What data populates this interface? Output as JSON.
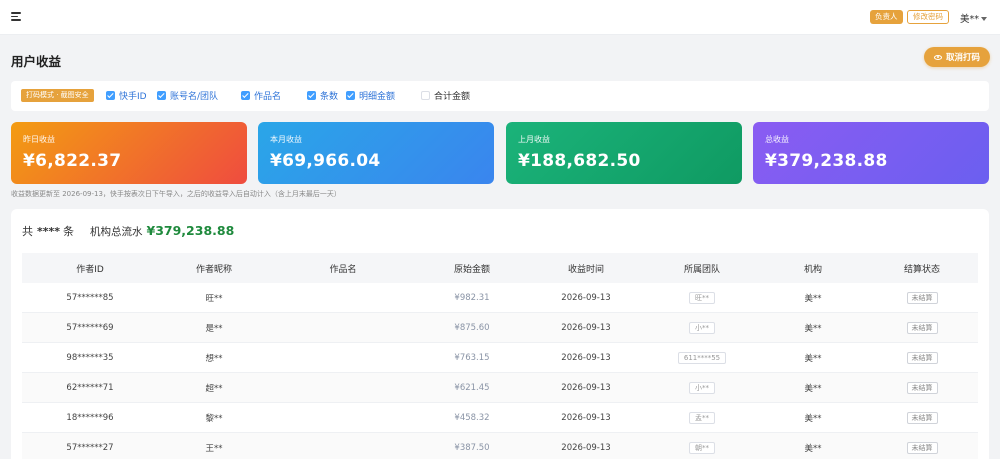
{
  "topbar": {
    "role_badge": "负责人",
    "change_password": "修改密码",
    "user": "美**"
  },
  "page": {
    "title": "用户收益",
    "cancel_print": "取消打码"
  },
  "filters": {
    "mode_tag": "打码模式 · 截图安全",
    "items": [
      {
        "label": "快手ID",
        "checked": true
      },
      {
        "label": "账号名/团队",
        "checked": true
      },
      {
        "label": "作品名",
        "checked": true
      },
      {
        "label": "条数",
        "checked": true
      },
      {
        "label": "明细金额",
        "checked": true
      },
      {
        "label": "合计金额",
        "checked": false
      }
    ]
  },
  "cards": [
    {
      "label": "昨日收益",
      "value": "¥6,822.37",
      "gradient": [
        "#f39c12",
        "#ef4c3f"
      ]
    },
    {
      "label": "本月收益",
      "value": "¥69,966.04",
      "gradient": [
        "#2aa6e8",
        "#3a85ee"
      ]
    },
    {
      "label": "上月收益",
      "value": "¥188,682.50",
      "gradient": [
        "#1bb37a",
        "#0f9a62"
      ]
    },
    {
      "label": "总收益",
      "value": "¥379,238.88",
      "gradient": [
        "#8a5cf2",
        "#6b5ff0"
      ]
    }
  ],
  "note": "收益数据更新至 2026-09-13，快手按表次日下午导入，之后的收益导入后自动计入（含上月末最后一天）",
  "summary": {
    "count_prefix": "共",
    "count": "****",
    "count_suffix": "条",
    "flow_label": "机构总流水",
    "flow_value": "¥379,238.88"
  },
  "table": {
    "headers": [
      "作者ID",
      "作者昵称",
      "作品名",
      "原始金额",
      "收益时间",
      "所属团队",
      "机构",
      "结算状态"
    ],
    "rows": [
      {
        "id": "57******85",
        "nick": "旺**",
        "work": "",
        "amount": "¥982.31",
        "date": "2026-09-13",
        "team": "旺**",
        "org": "美**",
        "status": "未结算"
      },
      {
        "id": "57******69",
        "nick": "是**",
        "work": "",
        "amount": "¥875.60",
        "date": "2026-09-13",
        "team": "小**",
        "org": "美**",
        "status": "未结算"
      },
      {
        "id": "98******35",
        "nick": "想**",
        "work": "",
        "amount": "¥763.15",
        "date": "2026-09-13",
        "team": "611****55",
        "org": "美**",
        "status": "未结算"
      },
      {
        "id": "62******71",
        "nick": "超**",
        "work": "",
        "amount": "¥621.45",
        "date": "2026-09-13",
        "team": "小**",
        "org": "美**",
        "status": "未结算"
      },
      {
        "id": "18******96",
        "nick": "黎**",
        "work": "",
        "amount": "¥458.32",
        "date": "2026-09-13",
        "team": "孟**",
        "org": "美**",
        "status": "未结算"
      },
      {
        "id": "57******27",
        "nick": "王**",
        "work": "",
        "amount": "¥387.50",
        "date": "2026-09-13",
        "team": "朝**",
        "org": "美**",
        "status": "未结算"
      }
    ]
  }
}
